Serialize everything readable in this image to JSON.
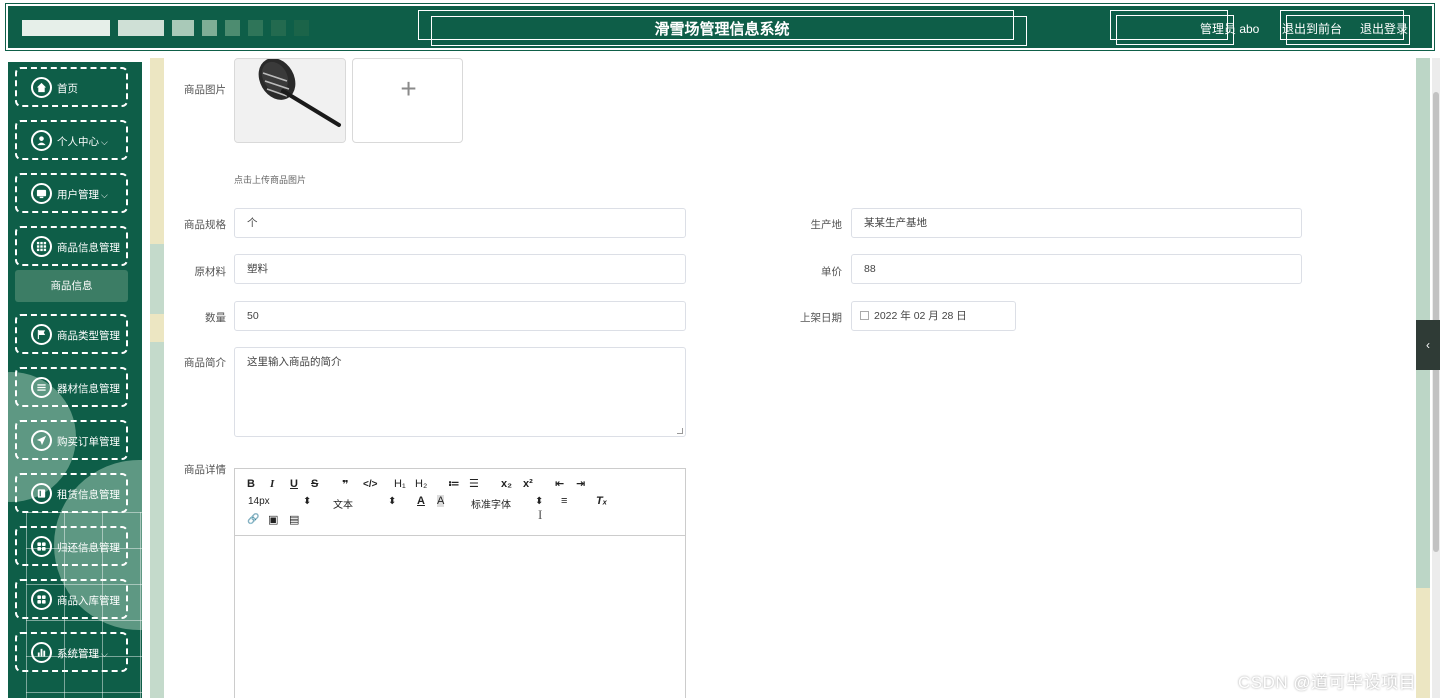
{
  "header": {
    "title": "滑雪场管理信息系统",
    "user": "管理员 abo",
    "to_front": "退出到前台",
    "logout": "退出登录"
  },
  "sidebar": {
    "items": [
      {
        "label": "首页",
        "icon": "home-icon"
      },
      {
        "label": "个人中心",
        "icon": "person-icon",
        "chevron": "⌵"
      },
      {
        "label": "用户管理",
        "icon": "monitor-icon",
        "chevron": "⌵"
      },
      {
        "label": "商品信息管理",
        "icon": "grid-icon"
      },
      {
        "label": "商品类型管理",
        "icon": "flag-icon"
      },
      {
        "label": "器材信息管理",
        "icon": "list-icon"
      },
      {
        "label": "购买订单管理",
        "icon": "send-icon"
      },
      {
        "label": "租赁信息管理",
        "icon": "book-icon"
      },
      {
        "label": "归还信息管理",
        "icon": "apps-icon"
      },
      {
        "label": "商品入库管理",
        "icon": "apps-icon"
      },
      {
        "label": "系统管理",
        "icon": "chart-icon",
        "chevron": "⌵"
      }
    ],
    "active_sub": "商品信息"
  },
  "form": {
    "image_label": "商品图片",
    "upload_plus": "+",
    "upload_tip": "点击上传商品图片",
    "spec_label": "商品规格",
    "spec_value": "个",
    "origin_label": "生产地",
    "origin_value": "某某生产基地",
    "material_label": "原材料",
    "material_value": "塑料",
    "price_label": "单价",
    "price_value": "88",
    "qty_label": "数量",
    "qty_value": "50",
    "date_label": "上架日期",
    "date_value": "2022 年 02 月 28 日",
    "intro_label": "商品简介",
    "intro_value": "这里输入商品的简介",
    "detail_label": "商品详情"
  },
  "editor": {
    "bold": "B",
    "italic": "I",
    "underline": "U",
    "strike": "S",
    "quote": "❞",
    "code": "</>",
    "h1": "H₁",
    "h2": "H₂",
    "ol": "≔",
    "ul": "☰",
    "sub": "x₂",
    "sup": "x²",
    "outdent": "⇤",
    "indent": "⇥",
    "size": "14px",
    "size_caret": "⬍",
    "text": "文本",
    "text_caret": "⬍",
    "font_color": "A",
    "bg_color": "A",
    "font": "标准字体",
    "font_caret": "⬍",
    "align": "≡",
    "clear": "Tₓ",
    "cursor": "I",
    "link": "🔗",
    "image": "▣",
    "video": "▤"
  },
  "ui": {
    "collapse": "‹"
  },
  "watermark": "CSDN @道可毕设项目",
  "colors": {
    "primary": "#0e5e48",
    "submenu_active": "#3c7d65"
  }
}
